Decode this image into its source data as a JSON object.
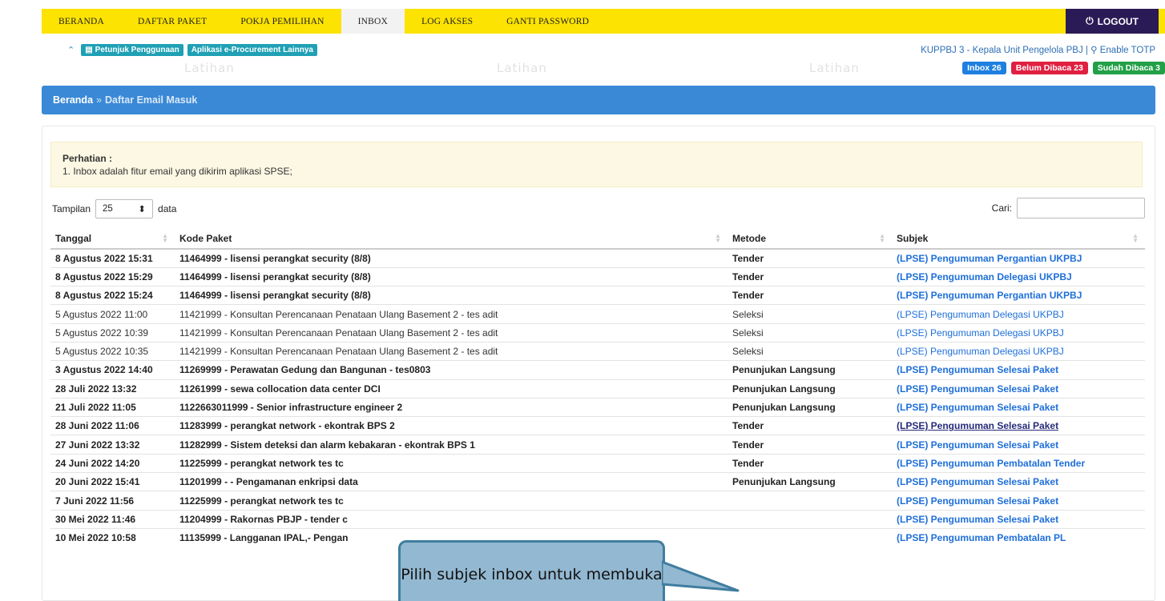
{
  "nav": {
    "items": [
      "BERANDA",
      "DAFTAR PAKET",
      "POKJA PEMILIHAN",
      "INBOX",
      "LOG AKSES",
      "GANTI PASSWORD"
    ],
    "active_index": 3,
    "logout_label": "LOGOUT",
    "logout_icon": "power-icon"
  },
  "subbar": {
    "petunjuk_label": "Petunjuk Penggunaan",
    "aplikasi_label": "Aplikasi e-Procurement Lainnya",
    "user_label": "KUPPBJ 3 - Kepala Unit Pengelola PBJ |",
    "totp_label": "Enable TOTP",
    "watermark": "Latihan"
  },
  "badges": {
    "inbox": "Inbox 26",
    "unread": "Belum Dibaca 23",
    "read": "Sudah Dibaca 3",
    "colors": {
      "inbox": "#1e7fe0",
      "unread": "#e02040",
      "read": "#22a047"
    }
  },
  "breadcrumb": {
    "home": "Beranda",
    "separator": "»",
    "current": "Daftar Email Masuk"
  },
  "notice": {
    "title": "Perhatian :",
    "line1": "1. Inbox adalah fitur email yang dikirim aplikasi SPSE;"
  },
  "controls": {
    "show_label": "Tampilan",
    "page_size": "25",
    "data_label": "data",
    "search_label": "Cari:"
  },
  "table": {
    "headers": [
      "Tanggal",
      "Kode Paket",
      "Metode",
      "Subjek"
    ],
    "rows": [
      {
        "tanggal": "8 Agustus 2022 15:31",
        "kode": "11464999 - lisensi perangkat security (8/8)",
        "metode": "Tender",
        "subjek": "(LPSE) Pengumuman Pergantian UKPBJ",
        "unread": true
      },
      {
        "tanggal": "8 Agustus 2022 15:29",
        "kode": "11464999 - lisensi perangkat security (8/8)",
        "metode": "Tender",
        "subjek": "(LPSE) Pengumuman Delegasi UKPBJ",
        "unread": true
      },
      {
        "tanggal": "8 Agustus 2022 15:24",
        "kode": "11464999 - lisensi perangkat security (8/8)",
        "metode": "Tender",
        "subjek": "(LPSE) Pengumuman Pergantian UKPBJ",
        "unread": true
      },
      {
        "tanggal": "5 Agustus 2022 11:00",
        "kode": "11421999 - Konsultan Perencanaan Penataan Ulang Basement 2 - tes adit",
        "metode": "Seleksi",
        "subjek": "(LPSE) Pengumuman Delegasi UKPBJ",
        "unread": false
      },
      {
        "tanggal": "5 Agustus 2022 10:39",
        "kode": "11421999 - Konsultan Perencanaan Penataan Ulang Basement 2 - tes adit",
        "metode": "Seleksi",
        "subjek": "(LPSE) Pengumuman Delegasi UKPBJ",
        "unread": false
      },
      {
        "tanggal": "5 Agustus 2022 10:35",
        "kode": "11421999 - Konsultan Perencanaan Penataan Ulang Basement 2 - tes adit",
        "metode": "Seleksi",
        "subjek": "(LPSE) Pengumuman Delegasi UKPBJ",
        "unread": false
      },
      {
        "tanggal": "3 Agustus 2022 14:40",
        "kode": "11269999 - Perawatan Gedung dan Bangunan - tes0803",
        "metode": "Penunjukan Langsung",
        "subjek": "(LPSE) Pengumuman Selesai Paket",
        "unread": true
      },
      {
        "tanggal": "28 Juli 2022 13:32",
        "kode": "11261999 - sewa collocation data center DCI",
        "metode": "Penunjukan Langsung",
        "subjek": "(LPSE) Pengumuman Selesai Paket",
        "unread": true
      },
      {
        "tanggal": "21 Juli 2022 11:05",
        "kode": "1122663011999 - Senior infrastructure engineer 2",
        "metode": "Penunjukan Langsung",
        "subjek": "(LPSE) Pengumuman Selesai Paket",
        "unread": true
      },
      {
        "tanggal": "28 Juni 2022 11:06",
        "kode": "11283999 - perangkat network - ekontrak BPS 2",
        "metode": "Tender",
        "subjek": "(LPSE) Pengumuman Selesai Paket",
        "unread": true,
        "hover": true
      },
      {
        "tanggal": "27 Juni 2022 13:32",
        "kode": "11282999 - Sistem deteksi dan alarm kebakaran - ekontrak BPS 1",
        "metode": "Tender",
        "subjek": "(LPSE) Pengumuman Selesai Paket",
        "unread": true
      },
      {
        "tanggal": "24 Juni 2022 14:20",
        "kode": "11225999 - perangkat network tes tc",
        "metode": "Tender",
        "subjek": "(LPSE) Pengumuman Pembatalan Tender",
        "unread": true
      },
      {
        "tanggal": "20 Juni 2022 15:41",
        "kode": "11201999 - - Pengamanan enkripsi data",
        "metode": "Penunjukan Langsung",
        "subjek": "(LPSE) Pengumuman Selesai Paket",
        "unread": true
      },
      {
        "tanggal": "7 Juni 2022 11:56",
        "kode": "11225999 - perangkat network tes tc",
        "metode": "",
        "subjek": "(LPSE) Pengumuman Selesai Paket",
        "unread": true
      },
      {
        "tanggal": "30 Mei 2022 11:46",
        "kode": "11204999 - Rakornas PBJP - tender c",
        "metode": "",
        "subjek": "(LPSE) Pengumuman Selesai Paket",
        "unread": true
      },
      {
        "tanggal": "10 Mei 2022 10:58",
        "kode": "11135999 - Langganan IPAL,- Pengan",
        "metode": "",
        "subjek": "(LPSE) Pengumuman Pembatalan PL",
        "unread": true
      }
    ]
  },
  "callout": {
    "text": "Pilih subjek inbox untuk membuka"
  }
}
